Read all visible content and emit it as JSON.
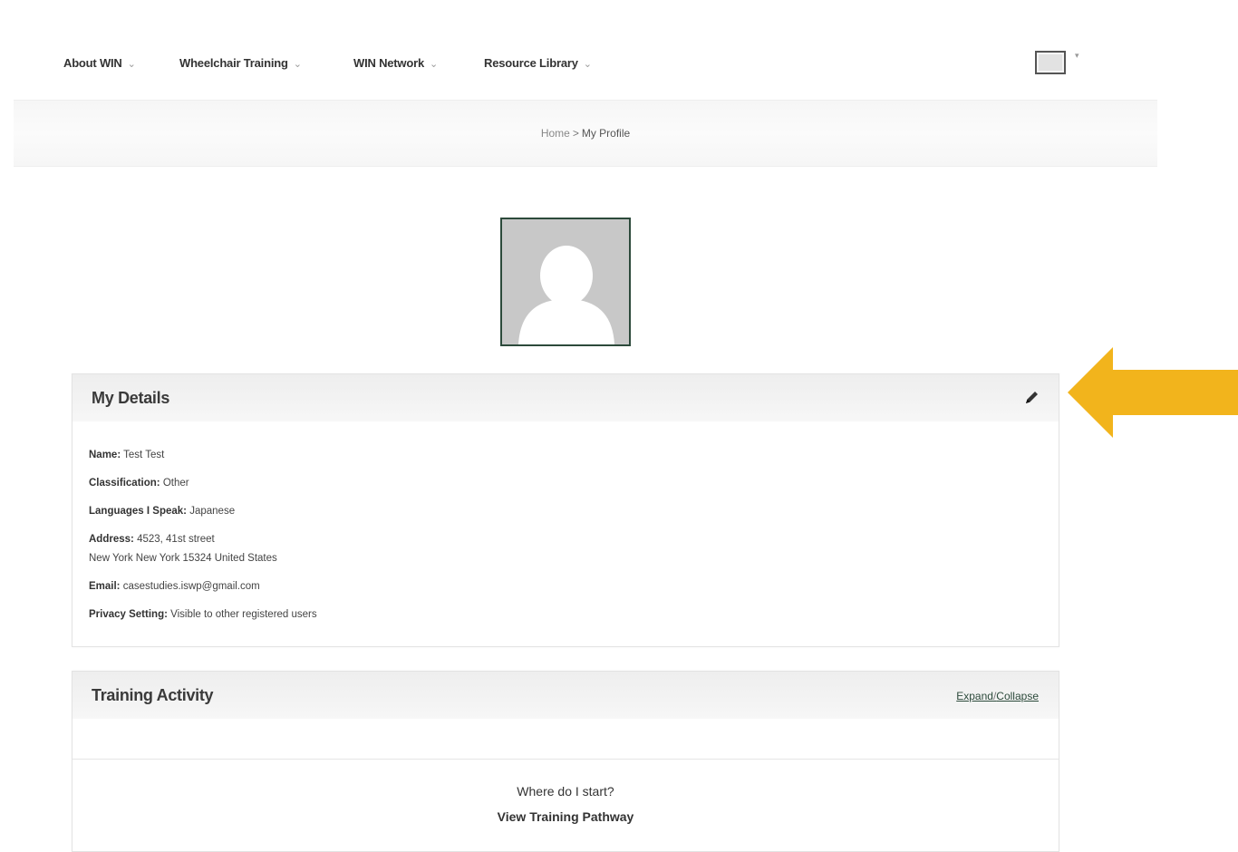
{
  "nav": {
    "items": [
      {
        "label": "About WIN"
      },
      {
        "label": "Wheelchair Training"
      },
      {
        "label": "WIN Network"
      },
      {
        "label": "Resource Library"
      }
    ],
    "caret": "⌄",
    "user_caret": "▾"
  },
  "breadcrumb": {
    "home": "Home",
    "separator": ">",
    "current": "My Profile"
  },
  "details": {
    "title": "My Details",
    "name_label": "Name:",
    "name_value": "Test Test",
    "classification_label": "Classification:",
    "classification_value": "Other",
    "languages_label": "Languages I Speak:",
    "languages_value": "Japanese",
    "address_label": "Address:",
    "address_line1": "4523, 41st street",
    "address_line2": "New York New York 15324 United States",
    "email_label": "Email:",
    "email_value": "casestudies.iswp@gmail.com",
    "privacy_label": "Privacy Setting:",
    "privacy_value": "Visible to other registered users"
  },
  "activity": {
    "title": "Training Activity",
    "expand_label": "Expand",
    "slash": "/",
    "collapse_label": "Collapse",
    "prompt": "Where do I start?",
    "pathway_link": "View Training Pathway"
  },
  "colors": {
    "accent_green": "#2c4a3b",
    "arrow": "#f2b41c"
  },
  "icons": {
    "edit": "pencil-icon",
    "user": "user-menu-icon",
    "avatar": "default-avatar-icon",
    "annotation": "callout-arrow-icon"
  }
}
